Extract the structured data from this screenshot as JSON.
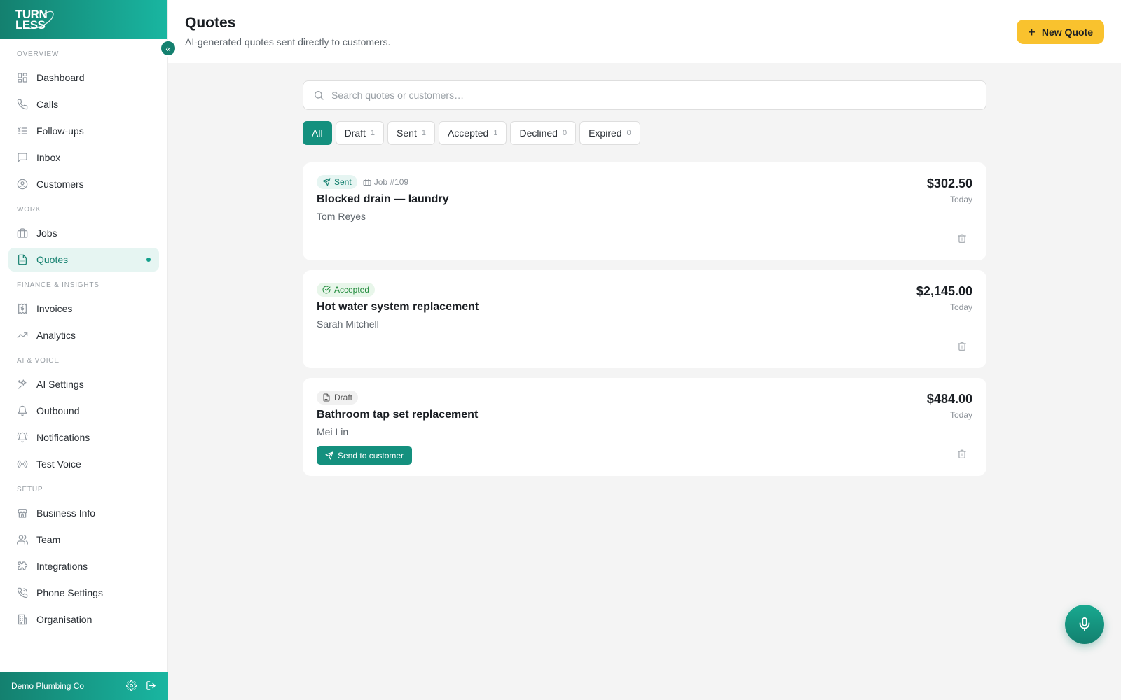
{
  "brand": {
    "logo_line1": "TURN",
    "logo_line2": "LESS"
  },
  "sidebar": {
    "sections": [
      {
        "title": "OVERVIEW",
        "items": [
          {
            "label": "Dashboard",
            "icon": "grid-icon"
          },
          {
            "label": "Calls",
            "icon": "phone-icon"
          },
          {
            "label": "Follow-ups",
            "icon": "list-check-icon"
          },
          {
            "label": "Inbox",
            "icon": "message-icon"
          },
          {
            "label": "Customers",
            "icon": "user-circle-icon"
          }
        ]
      },
      {
        "title": "WORK",
        "items": [
          {
            "label": "Jobs",
            "icon": "briefcase-icon"
          },
          {
            "label": "Quotes",
            "icon": "document-icon",
            "active": true
          }
        ]
      },
      {
        "title": "FINANCE & INSIGHTS",
        "items": [
          {
            "label": "Invoices",
            "icon": "receipt-icon"
          },
          {
            "label": "Analytics",
            "icon": "trend-icon"
          }
        ]
      },
      {
        "title": "AI & VOICE",
        "items": [
          {
            "label": "AI Settings",
            "icon": "sparkles-icon"
          },
          {
            "label": "Outbound",
            "icon": "bell-icon"
          },
          {
            "label": "Notifications",
            "icon": "bell-ring-icon"
          },
          {
            "label": "Test Voice",
            "icon": "broadcast-icon"
          }
        ]
      },
      {
        "title": "SETUP",
        "items": [
          {
            "label": "Business Info",
            "icon": "store-icon"
          },
          {
            "label": "Team",
            "icon": "users-icon"
          },
          {
            "label": "Integrations",
            "icon": "puzzle-icon"
          },
          {
            "label": "Phone Settings",
            "icon": "phone-settings-icon"
          },
          {
            "label": "Organisation",
            "icon": "building-icon"
          }
        ]
      }
    ],
    "footer": {
      "org_name": "Demo Plumbing Co"
    }
  },
  "header": {
    "title": "Quotes",
    "subtitle": "AI-generated quotes sent directly to customers.",
    "new_quote_label": "New Quote"
  },
  "search": {
    "placeholder": "Search quotes or customers…"
  },
  "filters": [
    {
      "label": "All",
      "count": "",
      "active": true
    },
    {
      "label": "Draft",
      "count": "1"
    },
    {
      "label": "Sent",
      "count": "1"
    },
    {
      "label": "Accepted",
      "count": "1"
    },
    {
      "label": "Declined",
      "count": "0"
    },
    {
      "label": "Expired",
      "count": "0"
    }
  ],
  "quotes": [
    {
      "status": "Sent",
      "status_key": "sent",
      "job_ref": "Job #109",
      "title": "Blocked drain — laundry",
      "customer": "Tom Reyes",
      "amount": "$302.50",
      "date": "Today"
    },
    {
      "status": "Accepted",
      "status_key": "accepted",
      "job_ref": "",
      "title": "Hot water system replacement",
      "customer": "Sarah Mitchell",
      "amount": "$2,145.00",
      "date": "Today"
    },
    {
      "status": "Draft",
      "status_key": "draft",
      "job_ref": "",
      "title": "Bathroom tap set replacement",
      "customer": "Mei Lin",
      "amount": "$484.00",
      "date": "Today",
      "action_label": "Send to customer"
    }
  ],
  "colors": {
    "brand": "#14806f",
    "brand_light": "#19b6a1",
    "accent": "#f9c22e"
  }
}
